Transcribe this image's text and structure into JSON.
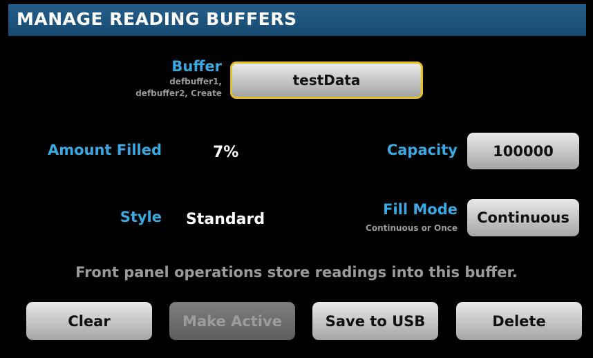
{
  "header": {
    "title": "MANAGE READING BUFFERS"
  },
  "buffer": {
    "label": "Buffer",
    "hint_line1": "defbuffer1,",
    "hint_line2": "defbuffer2, Create",
    "value": "testData"
  },
  "amount_filled": {
    "label": "Amount Filled",
    "value": "7%"
  },
  "capacity": {
    "label": "Capacity",
    "value": "100000"
  },
  "style": {
    "label": "Style",
    "value": "Standard"
  },
  "fill_mode": {
    "label": "Fill Mode",
    "hint": "Continuous or Once",
    "value": "Continuous"
  },
  "message": "Front panel operations store readings into this buffer.",
  "actions": {
    "clear": "Clear",
    "make_active": "Make Active",
    "save_to_usb": "Save to USB",
    "delete": "Delete"
  },
  "colors": {
    "title_bar": "#1f5a86",
    "label_blue": "#3aa9e2",
    "selected_border": "#e6c020"
  }
}
